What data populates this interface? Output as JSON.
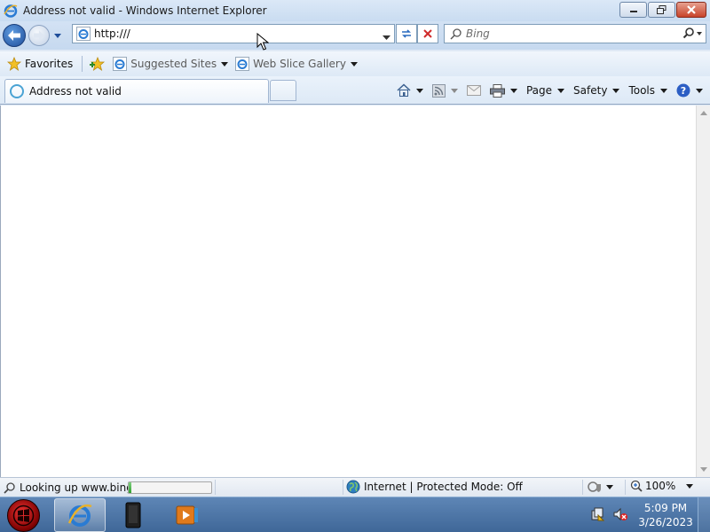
{
  "window": {
    "title": "Address not valid - Windows Internet Explorer"
  },
  "navigation": {
    "address_value": "http:///",
    "search_placeholder": "Bing"
  },
  "favorites_bar": {
    "favorites_label": "Favorites",
    "suggested_sites_label": "Suggested Sites",
    "web_slice_gallery_label": "Web Slice Gallery"
  },
  "tab": {
    "active_label": "Address not valid"
  },
  "command_bar": {
    "page_label": "Page",
    "safety_label": "Safety",
    "tools_label": "Tools"
  },
  "status_bar": {
    "text": "Looking up www.bing",
    "progress_fraction": 0.03,
    "zone_text": "Internet | Protected Mode: Off",
    "zoom_label": "100%"
  },
  "taskbar": {
    "time": "5:09 PM",
    "date": "3/26/2023"
  },
  "colors": {
    "accent": "#1e4d9a",
    "close_button": "#c8432a",
    "taskbar": "#4a72a4",
    "progress_fill": "#2fa02f"
  },
  "icons": [
    "ie-icon",
    "back-arrow-icon",
    "forward-arrow-icon",
    "refresh-icon",
    "stop-icon",
    "search-icon",
    "star-icon",
    "add-favorite-icon",
    "home-icon",
    "rss-feed-icon",
    "read-mail-icon",
    "print-icon",
    "help-icon",
    "globe-icon",
    "shield-icon",
    "zoom-icon",
    "start-orb-icon",
    "media-player-icon",
    "network-icon",
    "speaker-muted-icon"
  ]
}
